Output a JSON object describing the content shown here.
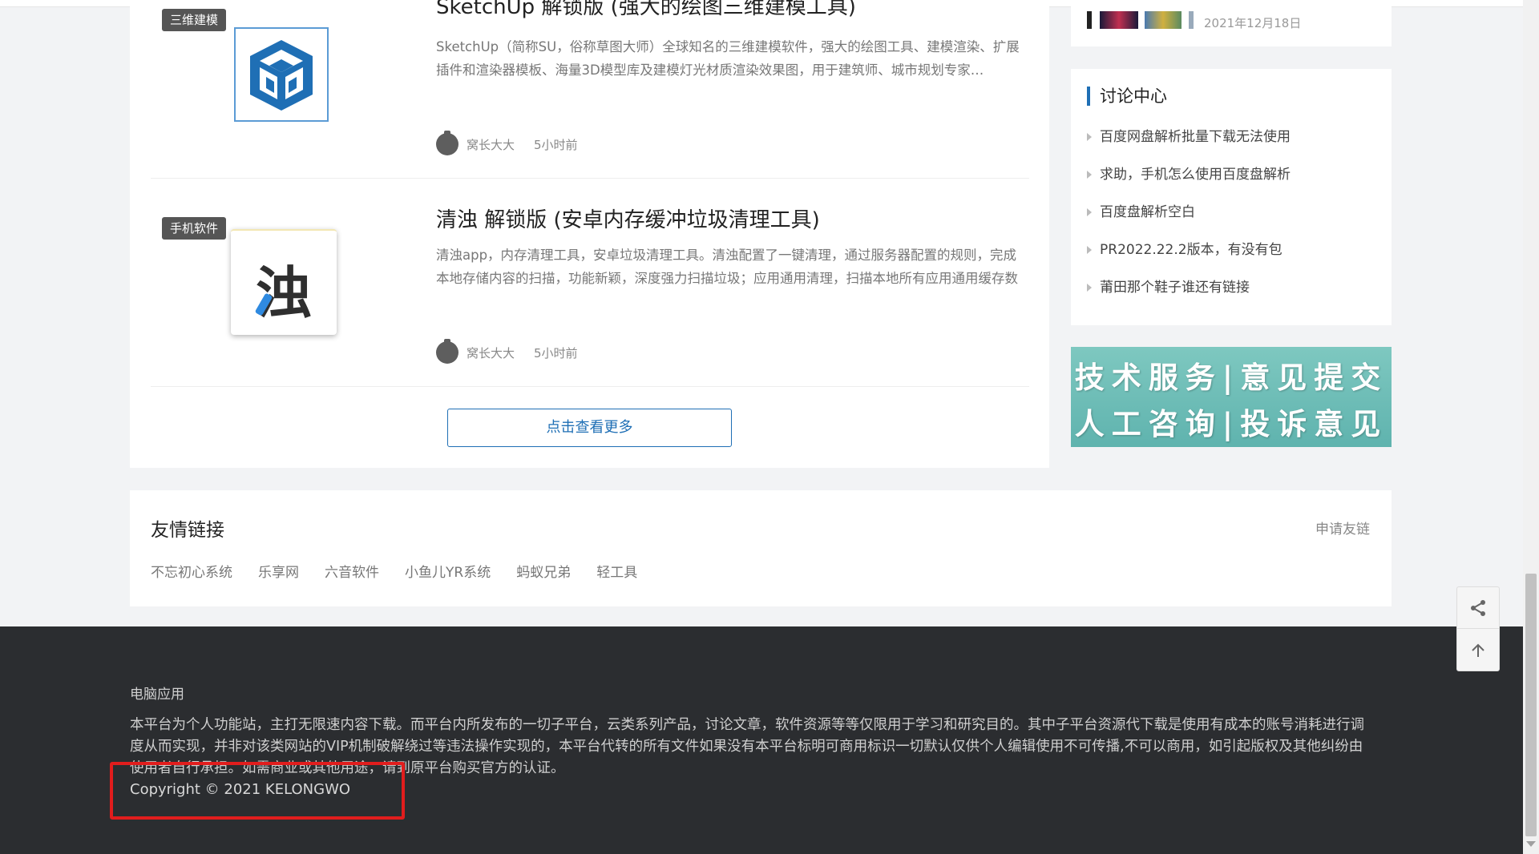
{
  "posts": [
    {
      "tag": "三维建模",
      "title": "SketchUp 解锁版 (强大的绘图三维建模工具)",
      "description": "SketchUp（简称SU，俗称草图大师）全球知名的三维建模软件，强大的绘图工具、建模渲染、扩展插件和渲染器模板、海量3D模型库及建模灯光材质渲染效果图，用于建筑师、城市规划专家…",
      "author": "窝长大大",
      "time": "5小时前",
      "thumb_icon": "sketchup-logo-icon"
    },
    {
      "tag": "手机软件",
      "title": "清浊 解锁版 (安卓内存缓冲垃圾清理工具)",
      "description": "清浊app，内存清理工具，安卓垃圾清理工具。清浊配置了一键清理，通过服务器配置的规则，完成本地存储内容的扫描，功能新颖，深度强力扫描垃圾；应用通用清理，扫描本地所有应用通用缓存数",
      "author": "窝长大大",
      "time": "5小时前",
      "thumb_char": "浊"
    }
  ],
  "more_button": "点击查看更多",
  "sidebar": {
    "top_card_date": "2021年12月18日",
    "discussion": {
      "title": "讨论中心",
      "items": [
        "百度网盘解析批量下载无法使用",
        "求助，手机怎么使用百度盘解析",
        "百度盘解析空白",
        "PR2022.22.2版本，有没有包",
        "莆田那个鞋子谁还有链接"
      ]
    },
    "banner": {
      "line1": "技术服务|意见提交",
      "line2": "人工咨询|投诉意见"
    }
  },
  "friend_links": {
    "title": "友情链接",
    "apply": "申请友链",
    "links": [
      "不忘初心系统",
      "乐享网",
      "六音软件",
      "小鱼儿YR系统",
      "蚂蚁兄弟",
      "轻工具"
    ]
  },
  "footer": {
    "category": "电脑应用",
    "disclaimer": "本平台为个人功能站，主打无限速内容下载。而平台内所发布的一切子平台，云类系列产品，讨论文章，软件资源等等仅限用于学习和研究目的。其中子平台资源代下载是使用有成本的账号消耗进行调度从而实现，并非对该类网站的VIP机制破解绕过等违法操作实现的，本平台代转的所有文件如果没有本平台标明可商用标识一切默认仅供个人编辑使用不可传播,不可以商用，如引起版权及其他纠纷由使用者自行承担。如需商业或其他用途，请到原平台购买官方的认证。",
    "copyright": "Copyright © 2021 KELONGWO"
  },
  "float_tools": {
    "share_icon": "share-icon",
    "top_icon": "arrow-up-icon"
  },
  "colors": {
    "accent": "#1f6fb5",
    "footer_bg": "#2b2d30",
    "highlight": "#e11d1d",
    "banner": "#6cbcb6"
  }
}
